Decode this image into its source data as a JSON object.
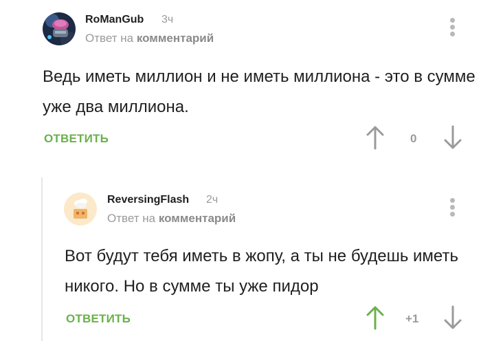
{
  "comments": [
    {
      "username": "RoManGub",
      "time": "3ч",
      "reply_prefix": "Ответ на",
      "reply_link": "комментарий",
      "text": "Ведь иметь миллион и не иметь миллиона - это в сумме уже два миллиона.",
      "reply_label": "ОТВЕТИТЬ",
      "score": "0",
      "up_color": "#9a9a9a"
    },
    {
      "username": "ReversingFlash",
      "time": "2ч",
      "reply_prefix": "Ответ на",
      "reply_link": "комментарий",
      "text": "Вот будут тебя иметь в жопу, а ты не будешь иметь никого. Но в сумме ты уже пидор",
      "reply_label": "ОТВЕТИТЬ",
      "score": "+1",
      "up_color": "#6ab04c"
    }
  ],
  "colors": {
    "accent": "#6ab04c",
    "muted": "#9a9a9a",
    "text": "#1f1f1f"
  }
}
